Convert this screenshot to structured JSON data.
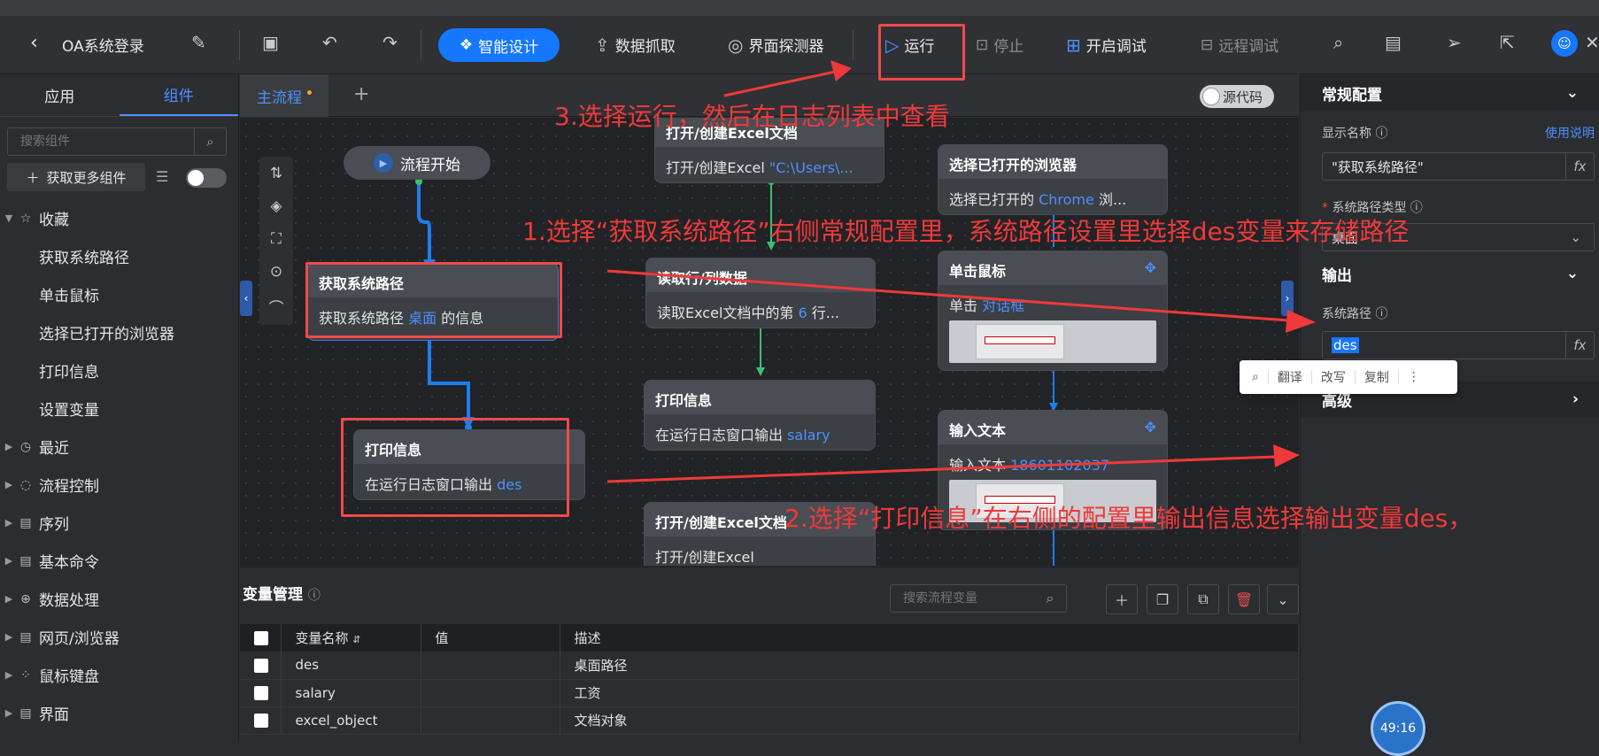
{
  "toolbar": {
    "title": "OA系统登录",
    "smart_design": "智能设计",
    "data_capture": "数据抓取",
    "ui_detector": "界面探测器",
    "run": "运行",
    "stop": "停止",
    "debug": "开启调试",
    "remote_debug": "远程调试"
  },
  "left_panel": {
    "tabs": [
      "应用",
      "组件"
    ],
    "search_placeholder": "搜索组件",
    "more_button": "获取更多组件",
    "favorites_label": "收藏",
    "favorites": [
      "获取系统路径",
      "单击鼠标",
      "选择已打开的浏览器",
      "打印信息",
      "设置变量"
    ],
    "categories": [
      "最近",
      "流程控制",
      "序列",
      "基本命令",
      "数据处理",
      "网页/浏览器",
      "鼠标键盘",
      "界面"
    ]
  },
  "canvas_tabs": {
    "main": "主流程",
    "source_code": "源代码"
  },
  "nodes": {
    "start": "流程开始",
    "get_path": {
      "title": "获取系统路径",
      "body_pre": "获取系统路径 ",
      "body_hl": "桌面",
      "body_post": " 的信息"
    },
    "print1": {
      "title": "打印信息",
      "body_pre": "在运行日志窗口输出 ",
      "body_hl": "des"
    },
    "excel_open": {
      "title": "打开/创建Excel文档",
      "body_pre": "打开/创建Excel ",
      "body_hl": "\"C:\\Users\\..."
    },
    "read_rows": {
      "title": "读取行/列数据",
      "body_pre": "读取Excel文档中的第 ",
      "body_hl": "6",
      "body_post": " 行..."
    },
    "print2": {
      "title": "打印信息",
      "body_pre": "在运行日志窗口输出 ",
      "body_hl": "salary"
    },
    "excel_open2": {
      "title": "打开/创建Excel文档",
      "body_pre": "打开/创建Excel"
    },
    "select_browser": {
      "title": "选择已打开的浏览器",
      "body_pre": "选择已打开的 ",
      "body_hl": "Chrome",
      "body_post": " 浏..."
    },
    "click_mouse": {
      "title": "单击鼠标",
      "body_pre": "单击 ",
      "body_hl": "对话框"
    },
    "input_text": {
      "title": "输入文本",
      "body_pre": "输入文本 ",
      "body_hl": "18601102037"
    }
  },
  "var_panel": {
    "title": "变量管理",
    "search_placeholder": "搜索流程变量",
    "columns": [
      "变量名称",
      "值",
      "描述"
    ],
    "rows": [
      {
        "name": "des",
        "value": "",
        "desc": "桌面路径"
      },
      {
        "name": "salary",
        "value": "",
        "desc": "工资"
      },
      {
        "name": "excel_object",
        "value": "",
        "desc": "文档对象"
      }
    ]
  },
  "right_panel": {
    "general_config": "常规配置",
    "display_name_label": "显示名称",
    "help_link": "使用说明",
    "display_name_value": "\"获取系统路径\"",
    "path_type_label": "系统路径类型",
    "path_type_value": "桌面",
    "output_section": "输出",
    "system_path_label": "系统路径",
    "system_path_value": "des",
    "advanced_section": "高级",
    "fx": "fx"
  },
  "popup": [
    "翻译",
    "改写",
    "复制"
  ],
  "timer": "49:16",
  "annotations": {
    "step1": "1.选择“获取系统路径”右侧常规配置里，系统路径设置里选择des变量来存储路径",
    "step2": "2.选择“打印信息”在右侧的配置里输出信息选择输出变量des，",
    "step3": "3.选择运行，然后在日志列表中查看"
  },
  "colors": {
    "accent": "#1677ff",
    "annotation": "#f0393a",
    "highlight": "#4d90ff"
  }
}
